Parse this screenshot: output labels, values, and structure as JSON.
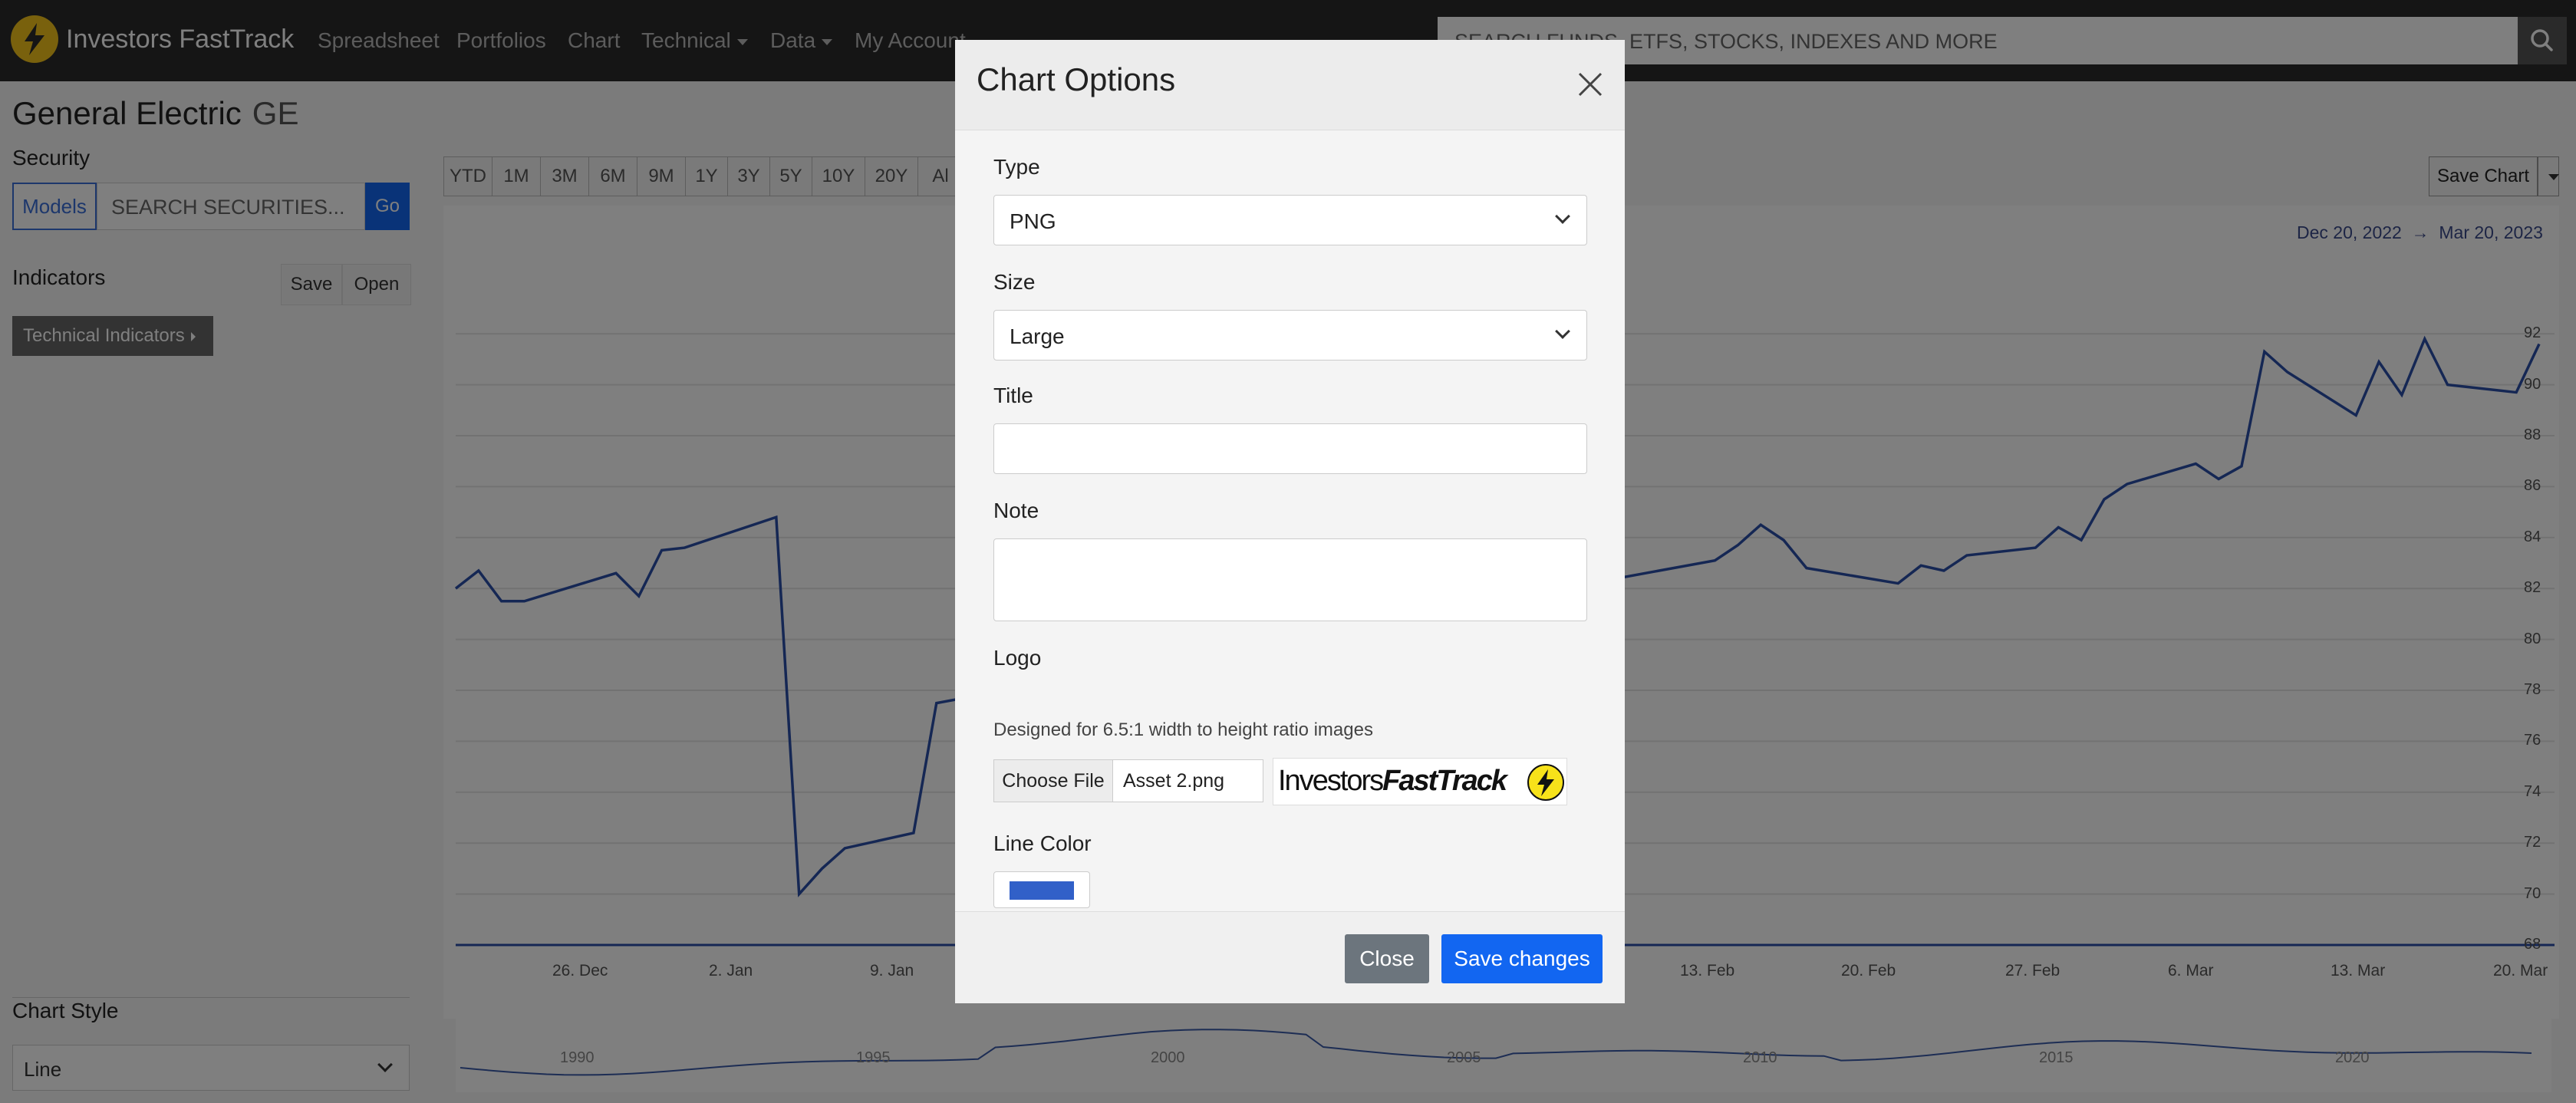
{
  "navbar": {
    "brand": "Investors FastTrack",
    "items": [
      {
        "label": "Spreadsheet",
        "dropdown": false
      },
      {
        "label": "Portfolios",
        "dropdown": false
      },
      {
        "label": "Chart",
        "dropdown": false
      },
      {
        "label": "Technical",
        "dropdown": true
      },
      {
        "label": "Data",
        "dropdown": true
      },
      {
        "label": "My Account",
        "dropdown": false
      }
    ],
    "search_placeholder": "SEARCH FUNDS, ETFS, STOCKS, INDEXES AND MORE"
  },
  "security": {
    "name": "General Electric",
    "ticker": "GE",
    "section_label": "Security",
    "models_label": "Models",
    "search_placeholder": "SEARCH SECURITIES...",
    "go_label": "Go"
  },
  "indicators": {
    "label": "Indicators",
    "save_label": "Save",
    "open_label": "Open",
    "technical_label": "Technical Indicators"
  },
  "chart_style": {
    "label": "Chart Style",
    "value": "Line"
  },
  "ranges": [
    "YTD",
    "1M",
    "3M",
    "6M",
    "9M",
    "1Y",
    "3Y",
    "5Y",
    "10Y",
    "20Y",
    "Al"
  ],
  "save_chart_label": "Save Chart",
  "chart_data": {
    "type": "line",
    "date_from": "Dec 20, 2022",
    "date_to": "Mar 20, 2023",
    "date_arrow": "→",
    "color": "#2b4fa8",
    "y_ticks": [
      68,
      70,
      72,
      74,
      76,
      78,
      80,
      82,
      84,
      86,
      88,
      90,
      92
    ],
    "ylim": [
      68,
      93
    ],
    "x_ticks": [
      "26. Dec",
      "2. Jan",
      "9. Jan",
      "13. Feb",
      "20. Feb",
      "27. Feb",
      "6. Mar",
      "13. Mar",
      "20. Mar"
    ],
    "series": [
      {
        "x": [
          "2022-12-20",
          "2022-12-21",
          "2022-12-22",
          "2022-12-23",
          "2022-12-27",
          "2022-12-28",
          "2022-12-29",
          "2022-12-30",
          "2023-01-03",
          "2023-01-04",
          "2023-01-05",
          "2023-01-06",
          "2023-01-09",
          "2023-01-10",
          "2023-02-13",
          "2023-02-14",
          "2023-02-15",
          "2023-02-16",
          "2023-02-17",
          "2023-02-21",
          "2023-02-22",
          "2023-02-23",
          "2023-02-24",
          "2023-02-27",
          "2023-02-28",
          "2023-03-01",
          "2023-03-02",
          "2023-03-03",
          "2023-03-06",
          "2023-03-07",
          "2023-03-08",
          "2023-03-09",
          "2023-03-10",
          "2023-03-13",
          "2023-03-14",
          "2023-03-15",
          "2023-03-16",
          "2023-03-17",
          "2023-03-20",
          "2023-03-21"
        ],
        "y": [
          82.0,
          82.7,
          81.5,
          81.5,
          82.6,
          81.7,
          83.5,
          83.6,
          84.8,
          70.0,
          71.0,
          71.8,
          72.4,
          77.5,
          83.1,
          83.7,
          84.5,
          83.9,
          82.8,
          82.2,
          82.9,
          82.7,
          83.3,
          83.6,
          84.4,
          83.9,
          85.5,
          86.1,
          86.9,
          86.3,
          86.8,
          91.3,
          90.5,
          88.8,
          90.9,
          89.6,
          91.8,
          90.0,
          89.7,
          91.6
        ]
      }
    ],
    "navigator_years": [
      "1990",
      "1995",
      "2000",
      "2005",
      "2010",
      "2015",
      "2020"
    ]
  },
  "modal": {
    "title": "Chart Options",
    "type_label": "Type",
    "type_value": "PNG",
    "size_label": "Size",
    "size_value": "Large",
    "title_label": "Title",
    "title_value": "",
    "note_label": "Note",
    "note_value": "",
    "logo_label": "Logo",
    "logo_hint": "Designed for 6.5:1 width to height ratio images",
    "choose_file_label": "Choose File",
    "file_name": "Asset 2.png",
    "logo_text_regular": "Investors",
    "logo_text_bold": "FastTrack",
    "line_color_label": "Line Color",
    "line_color": "#3160c8",
    "close_label": "Close",
    "save_label": "Save changes"
  }
}
